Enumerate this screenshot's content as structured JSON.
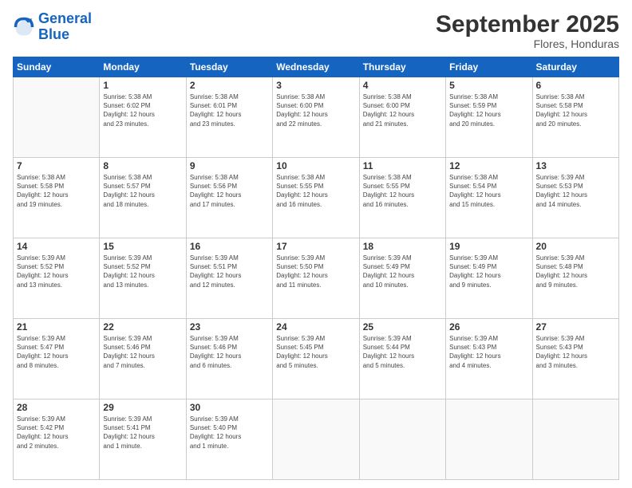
{
  "logo": {
    "line1": "General",
    "line2": "Blue"
  },
  "title": "September 2025",
  "subtitle": "Flores, Honduras",
  "header_days": [
    "Sunday",
    "Monday",
    "Tuesday",
    "Wednesday",
    "Thursday",
    "Friday",
    "Saturday"
  ],
  "weeks": [
    [
      {
        "day": "",
        "info": ""
      },
      {
        "day": "1",
        "info": "Sunrise: 5:38 AM\nSunset: 6:02 PM\nDaylight: 12 hours\nand 23 minutes."
      },
      {
        "day": "2",
        "info": "Sunrise: 5:38 AM\nSunset: 6:01 PM\nDaylight: 12 hours\nand 23 minutes."
      },
      {
        "day": "3",
        "info": "Sunrise: 5:38 AM\nSunset: 6:00 PM\nDaylight: 12 hours\nand 22 minutes."
      },
      {
        "day": "4",
        "info": "Sunrise: 5:38 AM\nSunset: 6:00 PM\nDaylight: 12 hours\nand 21 minutes."
      },
      {
        "day": "5",
        "info": "Sunrise: 5:38 AM\nSunset: 5:59 PM\nDaylight: 12 hours\nand 20 minutes."
      },
      {
        "day": "6",
        "info": "Sunrise: 5:38 AM\nSunset: 5:58 PM\nDaylight: 12 hours\nand 20 minutes."
      }
    ],
    [
      {
        "day": "7",
        "info": "Sunrise: 5:38 AM\nSunset: 5:58 PM\nDaylight: 12 hours\nand 19 minutes."
      },
      {
        "day": "8",
        "info": "Sunrise: 5:38 AM\nSunset: 5:57 PM\nDaylight: 12 hours\nand 18 minutes."
      },
      {
        "day": "9",
        "info": "Sunrise: 5:38 AM\nSunset: 5:56 PM\nDaylight: 12 hours\nand 17 minutes."
      },
      {
        "day": "10",
        "info": "Sunrise: 5:38 AM\nSunset: 5:55 PM\nDaylight: 12 hours\nand 16 minutes."
      },
      {
        "day": "11",
        "info": "Sunrise: 5:38 AM\nSunset: 5:55 PM\nDaylight: 12 hours\nand 16 minutes."
      },
      {
        "day": "12",
        "info": "Sunrise: 5:38 AM\nSunset: 5:54 PM\nDaylight: 12 hours\nand 15 minutes."
      },
      {
        "day": "13",
        "info": "Sunrise: 5:39 AM\nSunset: 5:53 PM\nDaylight: 12 hours\nand 14 minutes."
      }
    ],
    [
      {
        "day": "14",
        "info": "Sunrise: 5:39 AM\nSunset: 5:52 PM\nDaylight: 12 hours\nand 13 minutes."
      },
      {
        "day": "15",
        "info": "Sunrise: 5:39 AM\nSunset: 5:52 PM\nDaylight: 12 hours\nand 13 minutes."
      },
      {
        "day": "16",
        "info": "Sunrise: 5:39 AM\nSunset: 5:51 PM\nDaylight: 12 hours\nand 12 minutes."
      },
      {
        "day": "17",
        "info": "Sunrise: 5:39 AM\nSunset: 5:50 PM\nDaylight: 12 hours\nand 11 minutes."
      },
      {
        "day": "18",
        "info": "Sunrise: 5:39 AM\nSunset: 5:49 PM\nDaylight: 12 hours\nand 10 minutes."
      },
      {
        "day": "19",
        "info": "Sunrise: 5:39 AM\nSunset: 5:49 PM\nDaylight: 12 hours\nand 9 minutes."
      },
      {
        "day": "20",
        "info": "Sunrise: 5:39 AM\nSunset: 5:48 PM\nDaylight: 12 hours\nand 9 minutes."
      }
    ],
    [
      {
        "day": "21",
        "info": "Sunrise: 5:39 AM\nSunset: 5:47 PM\nDaylight: 12 hours\nand 8 minutes."
      },
      {
        "day": "22",
        "info": "Sunrise: 5:39 AM\nSunset: 5:46 PM\nDaylight: 12 hours\nand 7 minutes."
      },
      {
        "day": "23",
        "info": "Sunrise: 5:39 AM\nSunset: 5:46 PM\nDaylight: 12 hours\nand 6 minutes."
      },
      {
        "day": "24",
        "info": "Sunrise: 5:39 AM\nSunset: 5:45 PM\nDaylight: 12 hours\nand 5 minutes."
      },
      {
        "day": "25",
        "info": "Sunrise: 5:39 AM\nSunset: 5:44 PM\nDaylight: 12 hours\nand 5 minutes."
      },
      {
        "day": "26",
        "info": "Sunrise: 5:39 AM\nSunset: 5:43 PM\nDaylight: 12 hours\nand 4 minutes."
      },
      {
        "day": "27",
        "info": "Sunrise: 5:39 AM\nSunset: 5:43 PM\nDaylight: 12 hours\nand 3 minutes."
      }
    ],
    [
      {
        "day": "28",
        "info": "Sunrise: 5:39 AM\nSunset: 5:42 PM\nDaylight: 12 hours\nand 2 minutes."
      },
      {
        "day": "29",
        "info": "Sunrise: 5:39 AM\nSunset: 5:41 PM\nDaylight: 12 hours\nand 1 minute."
      },
      {
        "day": "30",
        "info": "Sunrise: 5:39 AM\nSunset: 5:40 PM\nDaylight: 12 hours\nand 1 minute."
      },
      {
        "day": "",
        "info": ""
      },
      {
        "day": "",
        "info": ""
      },
      {
        "day": "",
        "info": ""
      },
      {
        "day": "",
        "info": ""
      }
    ]
  ]
}
